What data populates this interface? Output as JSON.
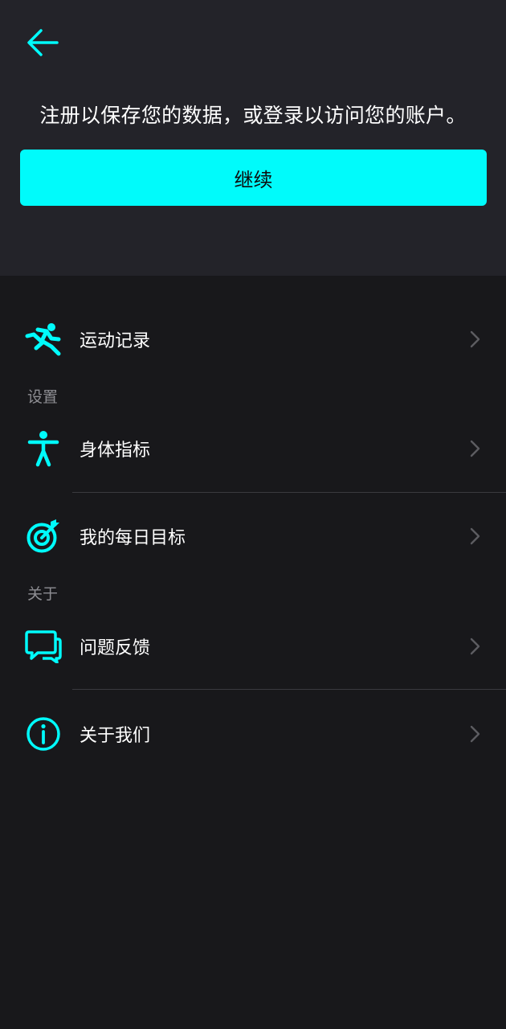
{
  "header": {
    "back_icon": "arrow-left-icon",
    "prompt": "注册以保存您的数据，或登录以访问您的账户。",
    "continue_label": "继续"
  },
  "colors": {
    "accent": "#00fbfb",
    "header_bg": "#232329",
    "page_bg": "#18181b",
    "section_text": "#8e8e93",
    "divider": "#3a3a3f"
  },
  "menu": {
    "workout_records": {
      "label": "运动记录",
      "icon": "running-icon"
    },
    "settings_title": "设置",
    "body_metrics": {
      "label": "身体指标",
      "icon": "person-icon"
    },
    "daily_goals": {
      "label": "我的每日目标",
      "icon": "target-icon"
    },
    "about_title": "关于",
    "feedback": {
      "label": "问题反馈",
      "icon": "chat-icon"
    },
    "about_us": {
      "label": "关于我们",
      "icon": "info-icon"
    }
  }
}
